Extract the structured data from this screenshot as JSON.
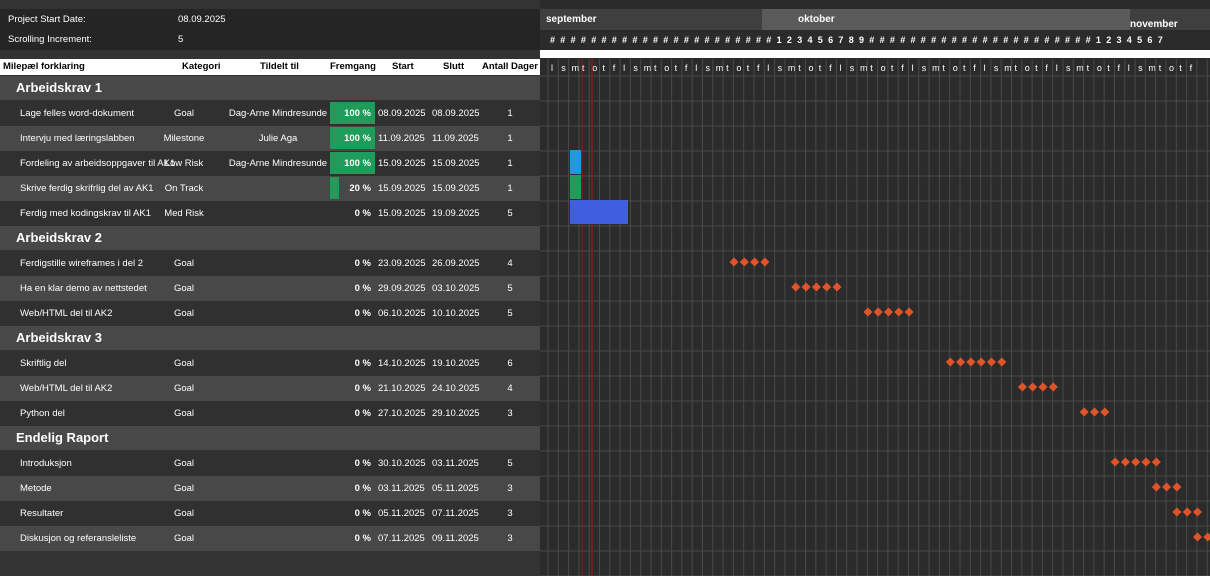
{
  "settings": {
    "project_start_label": "Project Start Date:",
    "project_start_value": "08.09.2025",
    "scrolling_label": "Scrolling Increment:",
    "scrolling_value": "5"
  },
  "columns": {
    "name": "Milepæl forklaring",
    "category": "Kategori",
    "assigned": "Tildelt til",
    "progress": "Fremgang",
    "start": "Start",
    "end": "Slutt",
    "days": "Antall Dager"
  },
  "sections": [
    {
      "title": "Arbeidskrav 1",
      "tasks": [
        {
          "name": "Lage felles word-dokument",
          "category": "Goal",
          "assigned": "Dag-Arne Mindresunde",
          "progress": "100 %",
          "progress_fraction": 1.0,
          "start": "08.09.2025",
          "end": "08.09.2025",
          "days": "1"
        },
        {
          "name": "Intervju med læringslabben",
          "category": "Milestone",
          "assigned": "Julie Aga",
          "progress": "100 %",
          "progress_fraction": 1.0,
          "start": "11.09.2025",
          "end": "11.09.2025",
          "days": "1"
        },
        {
          "name": "Fordeling av arbeidsoppgaver til AK1",
          "category": "Low Risk",
          "assigned": "Dag-Arne Mindresunde",
          "progress": "100 %",
          "progress_fraction": 1.0,
          "start": "15.09.2025",
          "end": "15.09.2025",
          "days": "1"
        },
        {
          "name": "Skrive ferdig skrifrlig del av AK1",
          "category": "On Track",
          "assigned": "",
          "progress": "20 %",
          "progress_fraction": 0.2,
          "start": "15.09.2025",
          "end": "15.09.2025",
          "days": "1"
        },
        {
          "name": "Ferdig med kodingskrav til AK1",
          "category": "Med Risk",
          "assigned": "",
          "progress": "0 %",
          "progress_fraction": 0,
          "start": "15.09.2025",
          "end": "19.09.2025",
          "days": "5"
        }
      ]
    },
    {
      "title": "Arbeidskrav 2",
      "tasks": [
        {
          "name": "Ferdigstille wireframes i del 2",
          "category": "Goal",
          "assigned": "",
          "progress": "0 %",
          "progress_fraction": 0,
          "start": "23.09.2025",
          "end": "26.09.2025",
          "days": "4"
        },
        {
          "name": "Ha en klar demo av nettstedet",
          "category": "Goal",
          "assigned": "",
          "progress": "0 %",
          "progress_fraction": 0,
          "start": "29.09.2025",
          "end": "03.10.2025",
          "days": "5"
        },
        {
          "name": "Web/HTML del til AK2",
          "category": "Goal",
          "assigned": "",
          "progress": "0 %",
          "progress_fraction": 0,
          "start": "06.10.2025",
          "end": "10.10.2025",
          "days": "5"
        }
      ]
    },
    {
      "title": "Arbeidskrav 3",
      "tasks": [
        {
          "name": "Skriftlig del",
          "category": "Goal",
          "assigned": "",
          "progress": "0 %",
          "progress_fraction": 0,
          "start": "14.10.2025",
          "end": "19.10.2025",
          "days": "6"
        },
        {
          "name": "Web/HTML del til AK2",
          "category": "Goal",
          "assigned": "",
          "progress": "0 %",
          "progress_fraction": 0,
          "start": "21.10.2025",
          "end": "24.10.2025",
          "days": "4"
        },
        {
          "name": "Python del",
          "category": "Goal",
          "assigned": "",
          "progress": "0 %",
          "progress_fraction": 0,
          "start": "27.10.2025",
          "end": "29.10.2025",
          "days": "3"
        }
      ]
    },
    {
      "title": "Endelig Raport",
      "tasks": [
        {
          "name": "Introduksjon",
          "category": "Goal",
          "assigned": "",
          "progress": "0 %",
          "progress_fraction": 0,
          "start": "30.10.2025",
          "end": "03.11.2025",
          "days": "5"
        },
        {
          "name": "Metode",
          "category": "Goal",
          "assigned": "",
          "progress": "0 %",
          "progress_fraction": 0,
          "start": "03.11.2025",
          "end": "05.11.2025",
          "days": "3"
        },
        {
          "name": "Resultater",
          "category": "Goal",
          "assigned": "",
          "progress": "0 %",
          "progress_fraction": 0,
          "start": "05.11.2025",
          "end": "07.11.2025",
          "days": "3"
        },
        {
          "name": "Diskusjon og referansleliste",
          "category": "Goal",
          "assigned": "",
          "progress": "0 %",
          "progress_fraction": 0,
          "start": "07.11.2025",
          "end": "09.11.2025",
          "days": "3"
        }
      ]
    }
  ],
  "gantt": {
    "months": [
      "september",
      "oktober",
      "november"
    ],
    "day_numbers": [
      "#",
      "#",
      "#",
      "#",
      "#",
      "#",
      "#",
      "#",
      "#",
      "#",
      "#",
      "#",
      "#",
      "#",
      "#",
      "#",
      "#",
      "#",
      "#",
      "#",
      "#",
      "#",
      "1",
      "2",
      "3",
      "4",
      "5",
      "6",
      "7",
      "8",
      "9",
      "#",
      "#",
      "#",
      "#",
      "#",
      "#",
      "#",
      "#",
      "#",
      "#",
      "#",
      "#",
      "#",
      "#",
      "#",
      "#",
      "#",
      "#",
      "#",
      "#",
      "#",
      "#",
      "1",
      "2",
      "3",
      "4",
      "5",
      "6",
      "7"
    ],
    "weekday_letters": [
      "l",
      "s",
      "m",
      "t",
      "o",
      "t",
      "f",
      "l",
      "s",
      "m",
      "t",
      "o",
      "t",
      "f",
      "l",
      "s",
      "m",
      "t",
      "o",
      "t",
      "f",
      "l",
      "s",
      "m",
      "t",
      "o",
      "t",
      "f",
      "l",
      "s",
      "m",
      "t",
      "o",
      "t",
      "f",
      "l",
      "s",
      "m",
      "t",
      "o",
      "t",
      "f",
      "l",
      "s",
      "m",
      "t",
      "o",
      "t",
      "f",
      "l",
      "s",
      "m",
      "t",
      "o",
      "t",
      "f",
      "l",
      "s",
      "m",
      "t",
      "o",
      "t",
      "f"
    ],
    "colors": {
      "header_month_sep": "#3f3f3f",
      "header_month_okt": "#5a5a5a",
      "header_month_nov": "#3f3f3f",
      "today_line": "#8b1a1a",
      "bar_blue": "#1e9be0",
      "bar_green": "#1f9b5a",
      "bar_royal": "#3f5fe0",
      "diamond": "#e0542a",
      "progress_fill": "#1f9b5a"
    }
  }
}
